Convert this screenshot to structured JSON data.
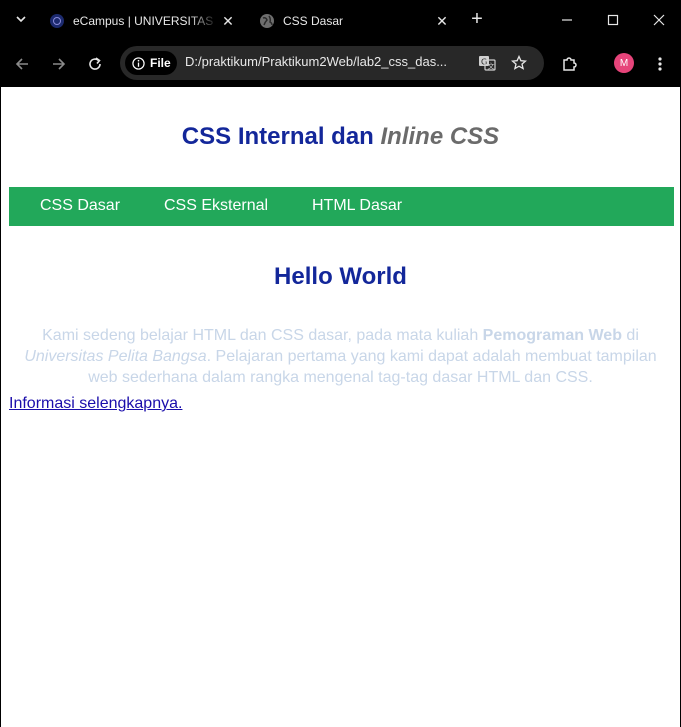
{
  "browser": {
    "tabs": [
      {
        "title": "eCampus | UNIVERSITAS PELITA BANGSA",
        "favicon": "university-logo-icon",
        "active": false
      },
      {
        "title": "CSS Dasar",
        "favicon": "globe-icon",
        "active": true
      }
    ],
    "address": {
      "scheme_chip": "File",
      "url": "D:/praktikum/Praktikum2Web/lab2_css_das..."
    },
    "profile_initial": "M",
    "colors": {
      "profile": "#e6447a",
      "frame": "#000000",
      "omnibox": "#282828"
    }
  },
  "page": {
    "heading": {
      "part1": "CSS Internal dan ",
      "part2": "Inline CSS"
    },
    "nav": [
      "CSS Dasar",
      "CSS Eksternal",
      "HTML Dasar"
    ],
    "hello": "Hello World",
    "paragraph": {
      "s1": "Kami sedeng belajar HTML dan CSS dasar, pada mata kuliah ",
      "bold": "Pemograman Web",
      "s2": " di ",
      "italic": "Universitas Pelita Bangsa",
      "s3": ". Pelajaran pertama yang kami dapat adalah membuat tampilan web sederhana dalam rangka mengenal tag-tag dasar HTML dan CSS."
    },
    "link": "Informasi selengkapnya.",
    "colors": {
      "heading": "#13279a",
      "nav_bg": "#22a85a",
      "paragraph": "#c8d6e8",
      "accent": "#6b6b6b"
    }
  }
}
